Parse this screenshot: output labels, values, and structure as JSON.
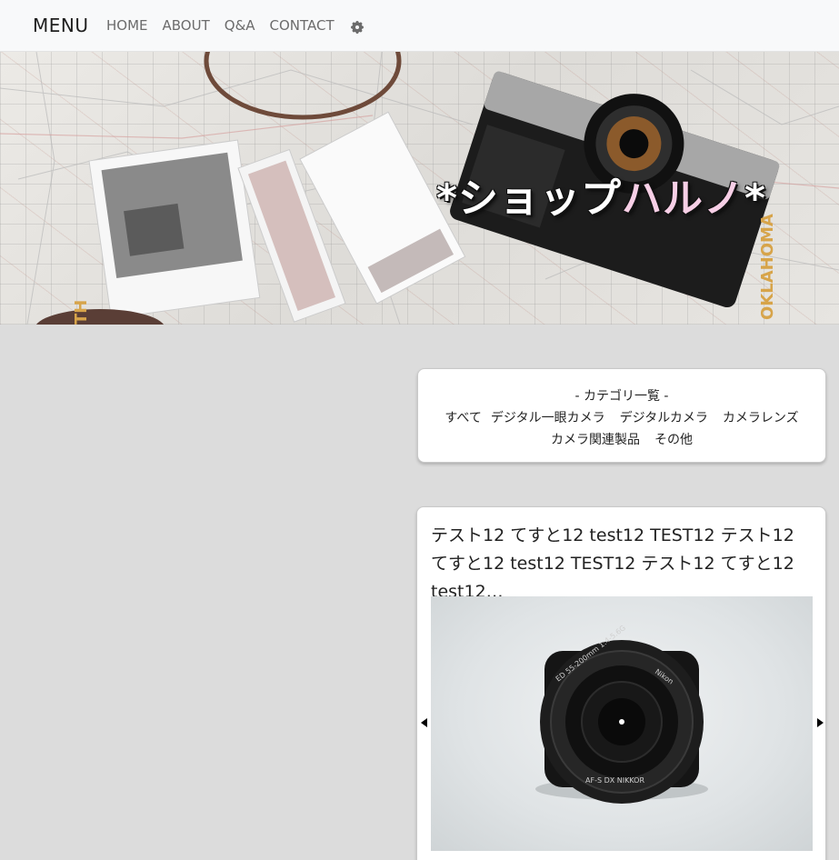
{
  "navbar": {
    "brand": "MENU",
    "links": [
      "HOME",
      "ABOUT",
      "Q&A",
      "CONTACT"
    ],
    "settings_icon": "gear-icon"
  },
  "hero": {
    "title_main": "*ショップ",
    "title_accent": "ハルノ",
    "title_end": "*",
    "accent_color": "#f7cfe6"
  },
  "categories": {
    "title": "- カテゴリ一覧 -",
    "row1": [
      "すべて",
      "デジタル一眼カメラ",
      "デジタルカメラ",
      "カメラレンズ"
    ],
    "row2": [
      "カメラ関連製品",
      "その他"
    ]
  },
  "product": {
    "title": "テスト12 てすと12 test12 TEST12 テスト12 てすと12 test12 TEST12 テスト12 てすと12 test12…",
    "image_icon": "camera-lens-photo",
    "prev_icon": "arrow-left-icon",
    "next_icon": "arrow-right-icon"
  }
}
